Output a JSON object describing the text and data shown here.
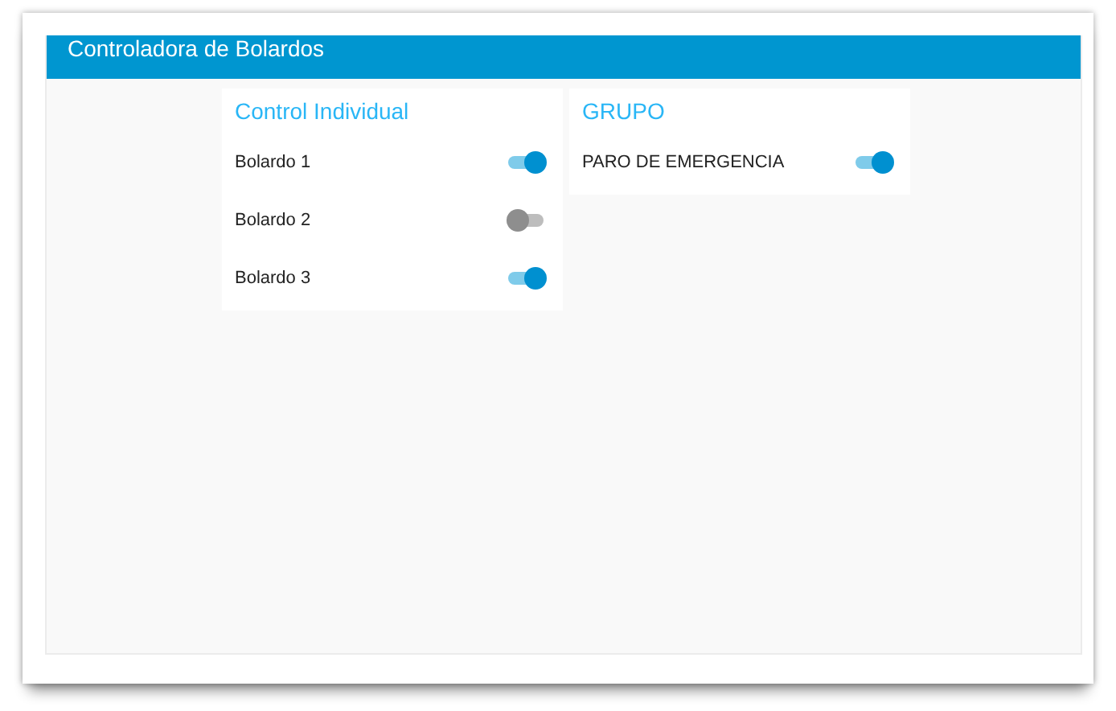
{
  "header": {
    "title": "Controladora de Bolardos"
  },
  "panels": [
    {
      "title": "Control Individual",
      "switches": [
        {
          "label": "Bolardo 1",
          "on": true
        },
        {
          "label": "Bolardo 2",
          "on": false
        },
        {
          "label": "Bolardo 3",
          "on": true
        }
      ]
    },
    {
      "title": "GRUPO",
      "switches": [
        {
          "label": "PARO DE EMERGENCIA",
          "on": true
        }
      ]
    }
  ]
}
